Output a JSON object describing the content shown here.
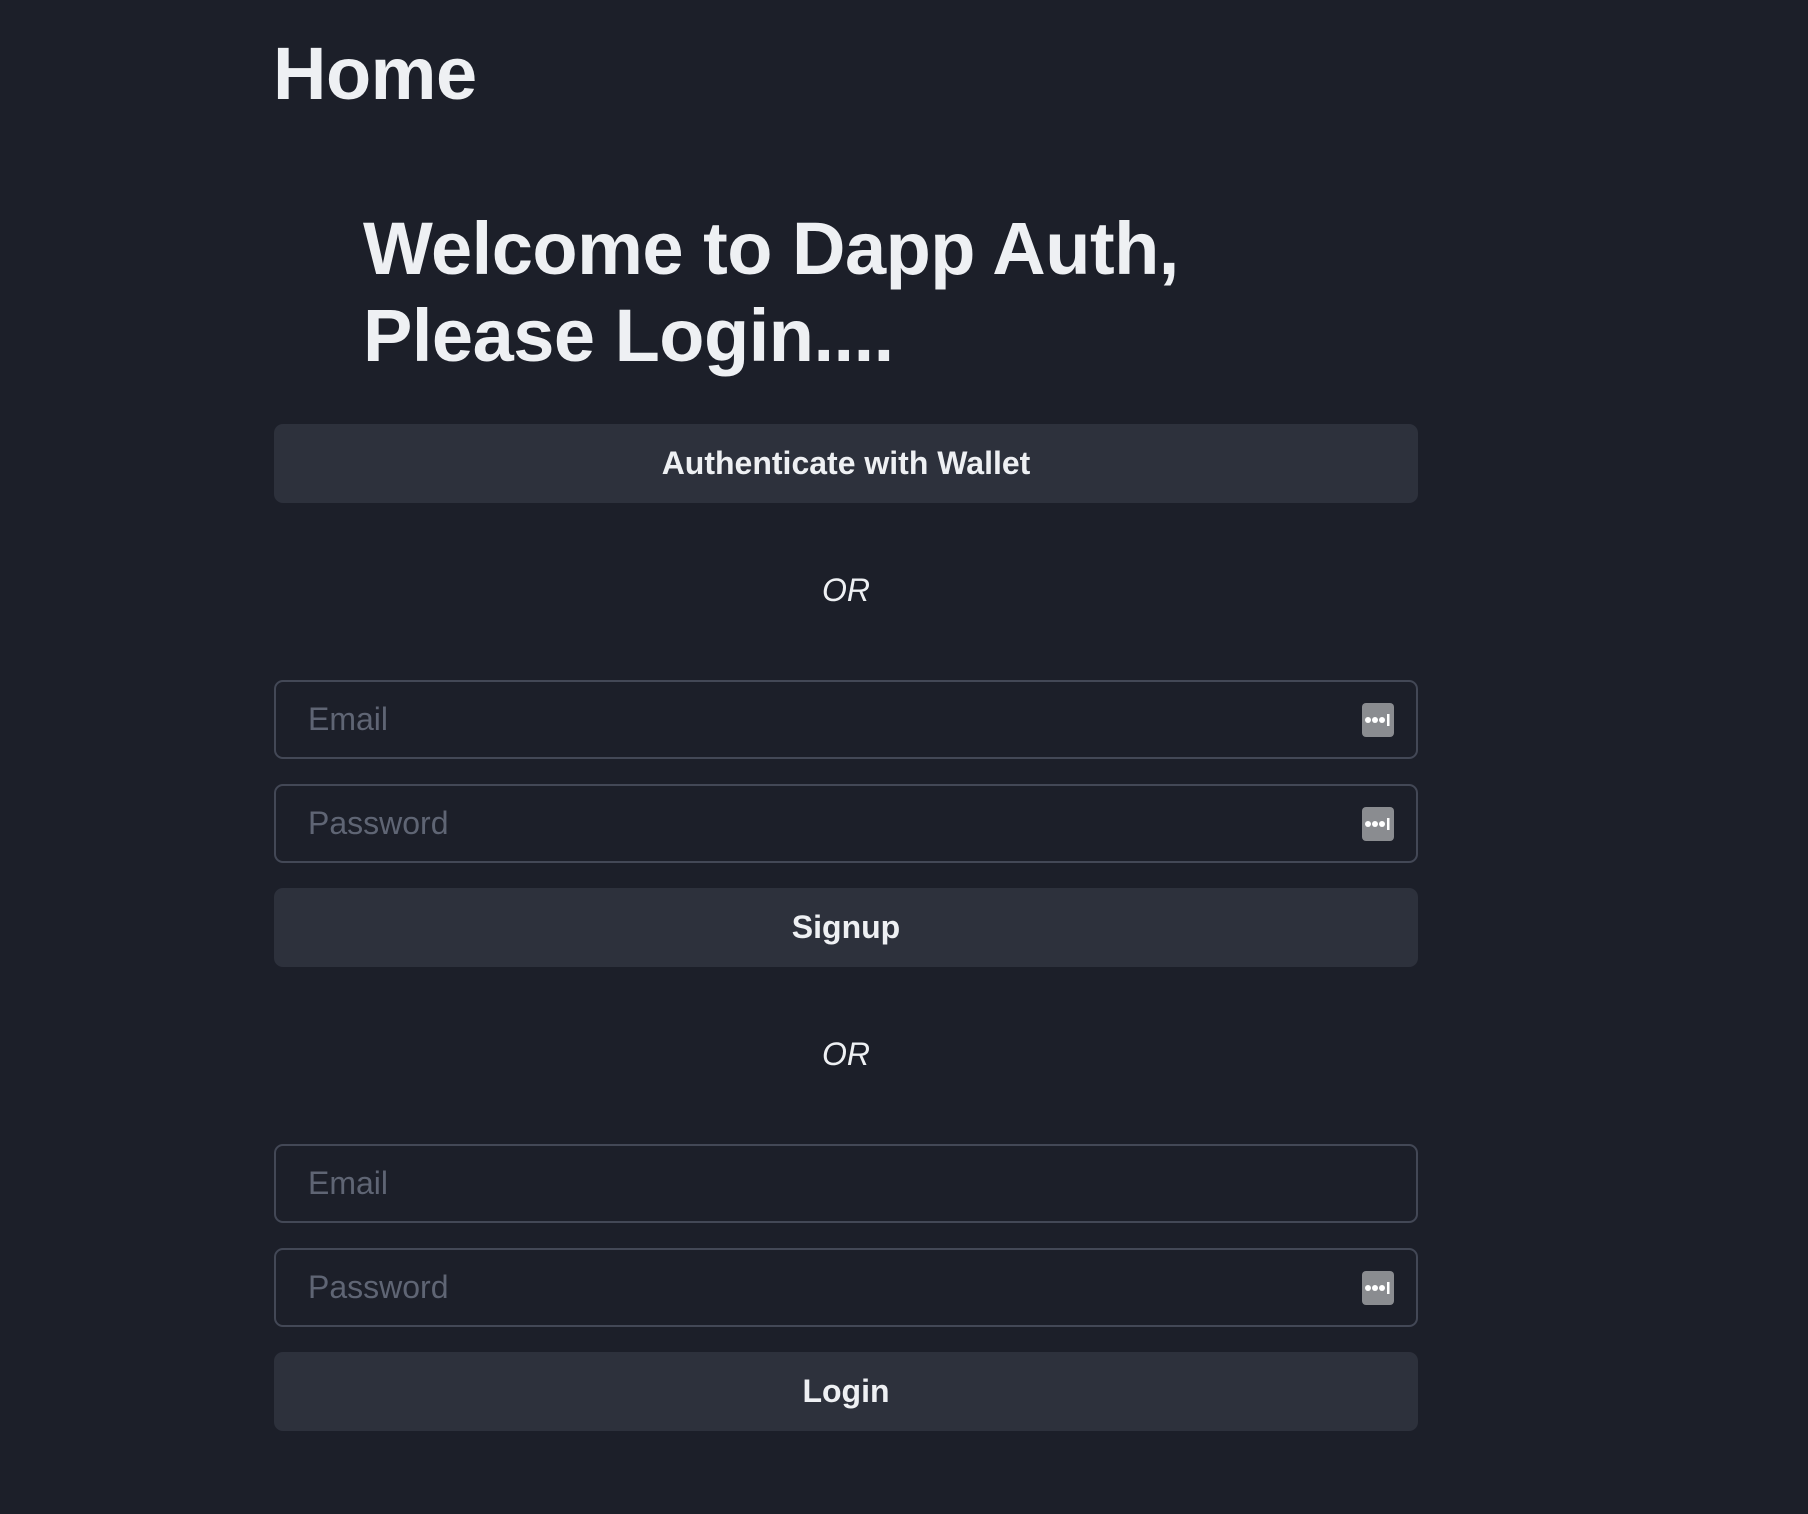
{
  "header": {
    "title": "Home"
  },
  "welcome": {
    "line1": "Welcome to Dapp Auth,",
    "line2": "Please Login...."
  },
  "wallet": {
    "button_label": "Authenticate with Wallet"
  },
  "divider_1": {
    "label": "OR"
  },
  "signup": {
    "email_placeholder": "Email",
    "password_placeholder": "Password",
    "button_label": "Signup"
  },
  "divider_2": {
    "label": "OR"
  },
  "login": {
    "email_placeholder": "Email",
    "password_placeholder": "Password",
    "button_label": "Login"
  },
  "icons": {
    "password_manager": "password-manager-icon"
  },
  "colors": {
    "background": "#1c1f29",
    "button": "#2d313c",
    "field_border": "#434856",
    "text": "#eef0f3",
    "placeholder": "#5f6574"
  }
}
